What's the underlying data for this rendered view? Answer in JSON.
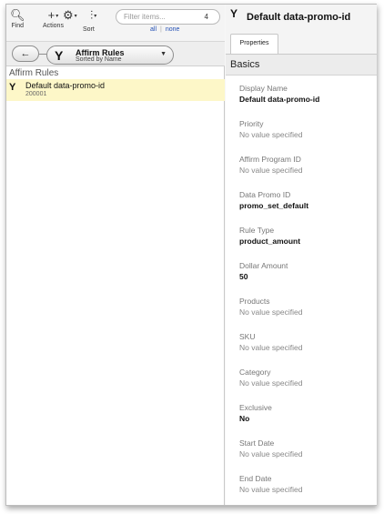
{
  "toolbar": {
    "find_label": "Find",
    "actions_label": "Actions",
    "sort_label": "Sort",
    "filter_placeholder": "Filter items...",
    "filter_count": "4",
    "all_link": "all",
    "none_link": "none"
  },
  "nav": {
    "back_glyph": "←",
    "breadcrumb_title": "Affirm Rules",
    "breadcrumb_subtitle": "Sorted by Name"
  },
  "list": {
    "header": "Affirm Rules",
    "items": [
      {
        "name": "Default data-promo-id",
        "id": "200001"
      }
    ]
  },
  "detail": {
    "title": "Default data-promo-id",
    "tab": "Properties",
    "section": "Basics",
    "properties": [
      {
        "label": "Display Name",
        "value": "Default data-promo-id"
      },
      {
        "label": "Priority",
        "value": "No value specified"
      },
      {
        "label": "Affirm Program ID",
        "value": "No value specified"
      },
      {
        "label": "Data Promo ID",
        "value": "promo_set_default"
      },
      {
        "label": "Rule Type",
        "value": "product_amount"
      },
      {
        "label": "Dollar Amount",
        "value": "50"
      },
      {
        "label": "Products",
        "value": "No value specified"
      },
      {
        "label": "SKU",
        "value": "No value specified"
      },
      {
        "label": "Category",
        "value": "No value specified"
      },
      {
        "label": "Exclusive",
        "value": "No"
      },
      {
        "label": "Start Date",
        "value": "No value specified"
      },
      {
        "label": "End Date",
        "value": "No value specified"
      }
    ]
  },
  "icons": {
    "find": "magnifier",
    "actions": "plus",
    "sort": "gear",
    "sort_extra": "bars",
    "rule": "branch"
  }
}
